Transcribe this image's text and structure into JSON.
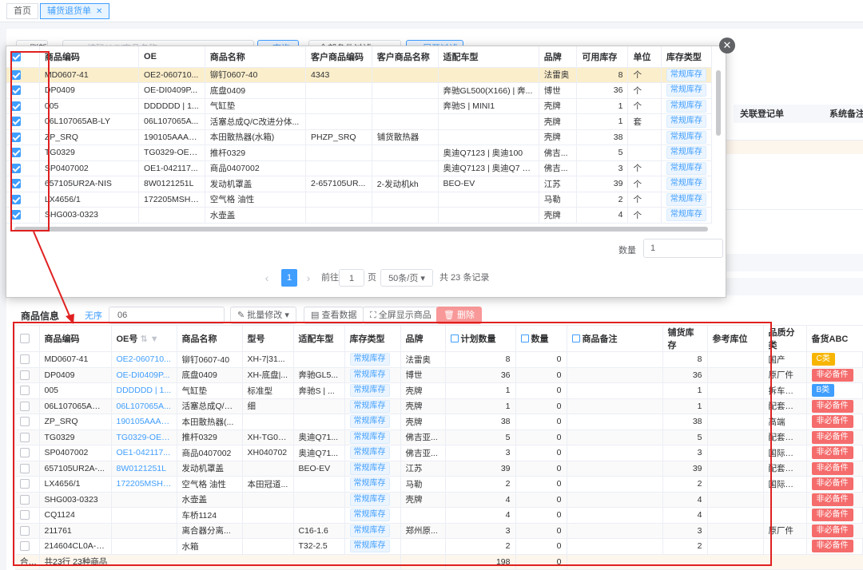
{
  "tabs": [
    {
      "label": "首页"
    },
    {
      "label": "辅货退货单"
    }
  ],
  "background": {
    "search_placeholder": "编码/OE/商品名称",
    "refresh_label": "刷新",
    "query_label": "查询",
    "filter_label": "全部条件过滤",
    "expand_label": "展开过滤",
    "col_related": "关联登记单",
    "col_sysnote": "系统备注"
  },
  "lower_toolbar": {
    "section_title": "商品信息",
    "tag": "无序",
    "search_value": "06",
    "batch_edit": "批量修改",
    "view_data": "查看数据",
    "fullscreen": "全屏显示商品",
    "delete": "删除"
  },
  "lower_table": {
    "headers": [
      "商品编码",
      "OE号",
      "商品名称",
      "型号",
      "适配车型",
      "库存类型",
      "品牌",
      "计划数量",
      "数量",
      "商品备注",
      "铺货库存",
      "参考库位",
      "品质分类",
      "备货ABC"
    ],
    "rows": [
      {
        "code": "MD0607-41",
        "oe": "OE2-060710...",
        "name": "铆钉0607-40",
        "model": "XH-7|31...",
        "car": "",
        "stock": "常规库存",
        "brand": "法雷奥",
        "plan": "8",
        "qty": "0",
        "note": "",
        "dist": "8",
        "loc": "",
        "quality": "国产",
        "abc": "C类",
        "abc_type": "C"
      },
      {
        "code": "DP0409",
        "oe": "OE-DI0409P...",
        "name": "底盘0409",
        "model": "XH-底盘|...",
        "car": "奔驰GL5...",
        "stock": "常规库存",
        "brand": "博世",
        "plan": "36",
        "qty": "0",
        "note": "",
        "dist": "36",
        "loc": "",
        "quality": "原厂件",
        "abc": "非必备件",
        "abc_type": "N"
      },
      {
        "code": "005",
        "oe": "DDDDDD | 1...",
        "name": "气缸垫",
        "model": "标准型",
        "car": "奔驰S | ...",
        "stock": "常规库存",
        "brand": "壳牌",
        "plan": "1",
        "qty": "0",
        "note": "",
        "dist": "1",
        "loc": "",
        "quality": "拆车配套",
        "abc": "B类",
        "abc_type": "B"
      },
      {
        "code": "06L107065AB-...",
        "oe": "06L107065A...",
        "name": "活塞总成Q/C...",
        "model": "细",
        "car": "",
        "stock": "常规库存",
        "brand": "壳牌",
        "plan": "1",
        "qty": "0",
        "note": "",
        "dist": "1",
        "loc": "",
        "quality": "配套厂件",
        "abc": "非必备件",
        "abc_type": "N"
      },
      {
        "code": "ZP_SRQ",
        "oe": "190105AAA0...",
        "name": "本田散热器(...",
        "model": "",
        "car": "",
        "stock": "常规库存",
        "brand": "壳牌",
        "plan": "38",
        "qty": "0",
        "note": "",
        "dist": "38",
        "loc": "",
        "quality": "高端",
        "abc": "非必备件",
        "abc_type": "N"
      },
      {
        "code": "TG0329",
        "oe": "TG0329-OE1...",
        "name": "推杆0329",
        "model": "XH-TG03...",
        "car": "奥迪Q71...",
        "stock": "常规库存",
        "brand": "佛吉亚...",
        "plan": "5",
        "qty": "0",
        "note": "",
        "dist": "5",
        "loc": "",
        "quality": "配套厂件",
        "abc": "非必备件",
        "abc_type": "N"
      },
      {
        "code": "SP0407002",
        "oe": "OE1-042117...",
        "name": "商品0407002",
        "model": "XH040702",
        "car": "奥迪Q71...",
        "stock": "常规库存",
        "brand": "佛吉亚...",
        "plan": "3",
        "qty": "0",
        "note": "",
        "dist": "3",
        "loc": "",
        "quality": "国际品牌",
        "abc": "非必备件",
        "abc_type": "N"
      },
      {
        "code": "657105UR2A-...",
        "oe": "8W0121251L",
        "name": "发动机罩盖",
        "model": "",
        "car": "BEO-EV",
        "stock": "常规库存",
        "brand": "江苏",
        "plan": "39",
        "qty": "0",
        "note": "",
        "dist": "39",
        "loc": "",
        "quality": "配套厂件",
        "abc": "非必备件",
        "abc_type": "N"
      },
      {
        "code": "LX4656/1",
        "oe": "172205MSH00",
        "name": "空气格 油性",
        "model": "本田冠道...",
        "car": "",
        "stock": "常规库存",
        "brand": "马勒",
        "plan": "2",
        "qty": "0",
        "note": "",
        "dist": "2",
        "loc": "",
        "quality": "国际品牌",
        "abc": "非必备件",
        "abc_type": "N"
      },
      {
        "code": "SHG003-0323",
        "oe": "",
        "name": "水壶盖",
        "model": "",
        "car": "",
        "stock": "常规库存",
        "brand": "壳牌",
        "plan": "4",
        "qty": "0",
        "note": "",
        "dist": "4",
        "loc": "",
        "quality": "",
        "abc": "非必备件",
        "abc_type": "N"
      },
      {
        "code": "CQ1124",
        "oe": "",
        "name": "车桥1124",
        "model": "",
        "car": "",
        "stock": "常规库存",
        "brand": "",
        "plan": "4",
        "qty": "0",
        "note": "",
        "dist": "4",
        "loc": "",
        "quality": "",
        "abc": "非必备件",
        "abc_type": "N"
      },
      {
        "code": "211761",
        "oe": "",
        "name": "离合器分离...",
        "model": "",
        "car": "C16-1.6",
        "stock": "常规库存",
        "brand": "郑州原...",
        "plan": "3",
        "qty": "0",
        "note": "",
        "dist": "3",
        "loc": "",
        "quality": "原厂件",
        "abc": "非必备件",
        "abc_type": "N"
      },
      {
        "code": "214604CL0A-C...",
        "oe": "",
        "name": "水箱",
        "model": "",
        "car": "T32-2.5",
        "stock": "常规库存",
        "brand": "",
        "plan": "2",
        "qty": "0",
        "note": "",
        "dist": "2",
        "loc": "",
        "quality": "",
        "abc": "非必备件",
        "abc_type": "N"
      }
    ],
    "summary": {
      "label": "合计",
      "count": "共23行 23种商品",
      "plan": "198",
      "qty": "0"
    }
  },
  "popup": {
    "headers": [
      "商品编码",
      "OE",
      "商品名称",
      "客户商品编码",
      "客户商品名称",
      "适配车型",
      "品牌",
      "可用库存",
      "单位",
      "库存类型"
    ],
    "rows": [
      {
        "code": "MD0607-41",
        "oe": "OE2-060710...",
        "name": "铆钉0607-40",
        "ccode": "4343",
        "cname": "",
        "car": "",
        "brand": "法雷奥",
        "avail": "8",
        "unit": "个",
        "stock": "常规库存"
      },
      {
        "code": "DP0409",
        "oe": "OE-DI0409P...",
        "name": "底盘0409",
        "ccode": "",
        "cname": "",
        "car": "奔驰GL500(X166) | 奔...",
        "brand": "博世",
        "avail": "36",
        "unit": "个",
        "stock": "常规库存"
      },
      {
        "code": "005",
        "oe": "DDDDDD | 1...",
        "name": "气缸垫",
        "ccode": "",
        "cname": "",
        "car": "奔驰S | MINI1",
        "brand": "壳牌",
        "avail": "1",
        "unit": "个",
        "stock": "常规库存"
      },
      {
        "code": "06L107065AB-LY",
        "oe": "06L107065A...",
        "name": "活塞总成Q/C改进分体...",
        "ccode": "",
        "cname": "",
        "car": "",
        "brand": "壳牌",
        "avail": "1",
        "unit": "套",
        "stock": "常规库存"
      },
      {
        "code": "ZP_SRQ",
        "oe": "190105AAA0...",
        "name": "本田散热器(水箱)",
        "ccode": "PHZP_SRQ",
        "cname": "铺货散热器",
        "car": "",
        "brand": "壳牌",
        "avail": "38",
        "unit": "",
        "stock": "常规库存"
      },
      {
        "code": "TG0329",
        "oe": "TG0329-OE1...",
        "name": "推杆0329",
        "ccode": "",
        "cname": "",
        "car": "奥迪Q7123 | 奥迪100",
        "brand": "佛吉...",
        "avail": "5",
        "unit": "",
        "stock": "常规库存"
      },
      {
        "code": "SP0407002",
        "oe": "OE1-042117...",
        "name": "商品0407002",
        "ccode": "",
        "cname": "",
        "car": "奥迪Q7123 | 奥迪Q7 3...",
        "brand": "佛吉...",
        "avail": "3",
        "unit": "个",
        "stock": "常规库存"
      },
      {
        "code": "657105UR2A-NIS",
        "oe": "8W0121251L",
        "name": "发动机罩盖",
        "ccode": "2-657105UR...",
        "cname": "2-发动机kh",
        "car": "BEO-EV",
        "brand": "江苏",
        "avail": "39",
        "unit": "个",
        "stock": "常规库存"
      },
      {
        "code": "LX4656/1",
        "oe": "172205MSH00",
        "name": "空气格 油性",
        "ccode": "",
        "cname": "",
        "car": "",
        "brand": "马勒",
        "avail": "2",
        "unit": "个",
        "stock": "常规库存"
      },
      {
        "code": "SHG003-0323",
        "oe": "",
        "name": "水壶盖",
        "ccode": "",
        "cname": "",
        "car": "",
        "brand": "壳牌",
        "avail": "4",
        "unit": "个",
        "stock": "常规库存"
      }
    ],
    "qty_label": "数量",
    "qty_value": "1",
    "pager": {
      "current": "1",
      "goto_prefix": "前往",
      "goto_value": "1",
      "goto_suffix": "页",
      "page_size": "50条/页",
      "total": "共 23 条记录"
    }
  },
  "colors": {
    "accent": "#409eff",
    "annotation": "#e02020",
    "danger": "#f56c6c"
  }
}
